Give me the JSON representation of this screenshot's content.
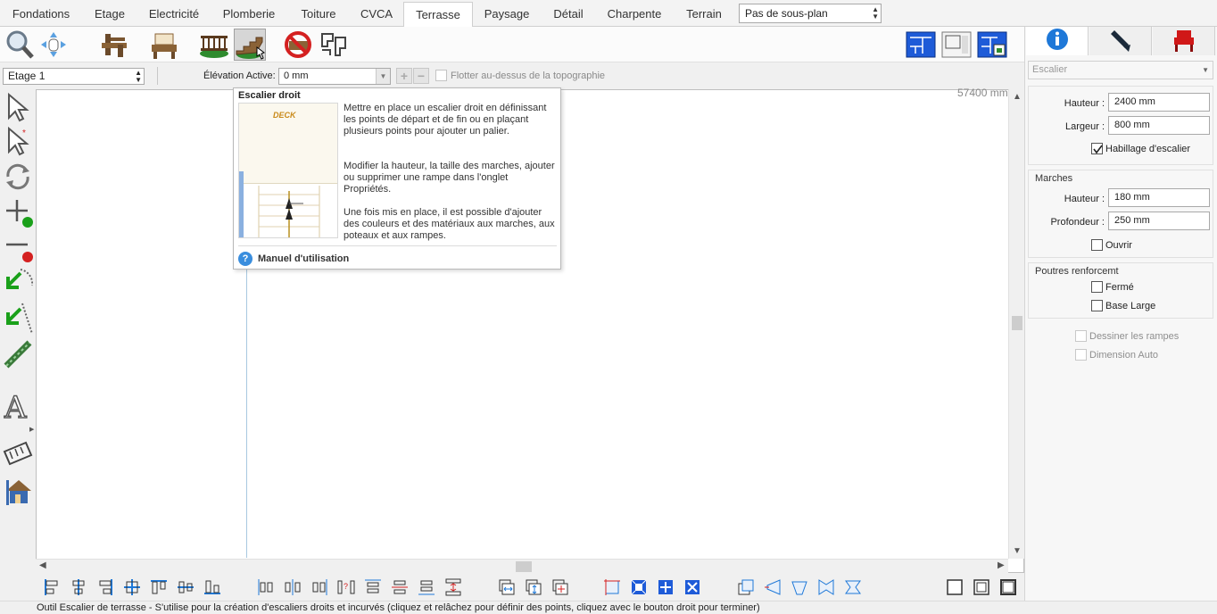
{
  "menu": {
    "tabs": [
      "Fondations",
      "Etage",
      "Electricité",
      "Plomberie",
      "Toiture",
      "CVCA",
      "Terrasse",
      "Paysage",
      "Détail",
      "Charpente",
      "Terrain"
    ],
    "active_tab": "Terrasse",
    "subplan": "Pas de sous-plan"
  },
  "elevation_bar": {
    "floor": "Etage 1",
    "label": "Élévation Active:",
    "value": "0 mm",
    "float_label": "Flotter au-dessus de la topographie"
  },
  "canvas": {
    "coordinate_readout": "57400 mm"
  },
  "tooltip": {
    "title": "Escalier droit",
    "image_label": "DECK",
    "paragraph1": "Mettre en place un escalier droit en définissant les points de départ et de fin ou en plaçant plusieurs points pour ajouter un palier.",
    "paragraph2": "Modifier la hauteur, la taille des marches, ajouter ou supprimer une rampe dans l'onglet Propriétés.",
    "paragraph3": "Une fois mis en place, il est possible d'ajouter des couleurs et des matériaux aux marches, aux poteaux et aux rampes.",
    "help_link": "Manuel d'utilisation"
  },
  "properties": {
    "object_type": "Escalier",
    "hauteur_label": "Hauteur :",
    "hauteur": "2400 mm",
    "largeur_label": "Largeur :",
    "largeur": "800 mm",
    "habillage_label": "Habillage d'escalier",
    "habillage_checked": true,
    "marches": {
      "title": "Marches",
      "hauteur_label": "Hauteur :",
      "hauteur": "180 mm",
      "profondeur_label": "Profondeur :",
      "profondeur": "250 mm",
      "ouvrir_label": "Ouvrir"
    },
    "poutres": {
      "title": "Poutres renforcemt",
      "ferme_label": "Fermé",
      "base_large_label": "Base Large"
    },
    "dessiner_rampes_label": "Dessiner les rampes",
    "dimension_auto_label": "Dimension Auto"
  },
  "status_bar": "Outil Escalier de terrasse - S'utilise pour la création d'escaliers droits et incurvés (cliquez et relâchez pour définir des points, cliquez avec le bouton droit pour terminer)",
  "colors": {
    "accent_blue": "#1e78d8",
    "deck_brown": "#6b4a2a",
    "stop_red": "#d42020",
    "grass_green": "#2e8b2e",
    "chair_red": "#d01818"
  }
}
